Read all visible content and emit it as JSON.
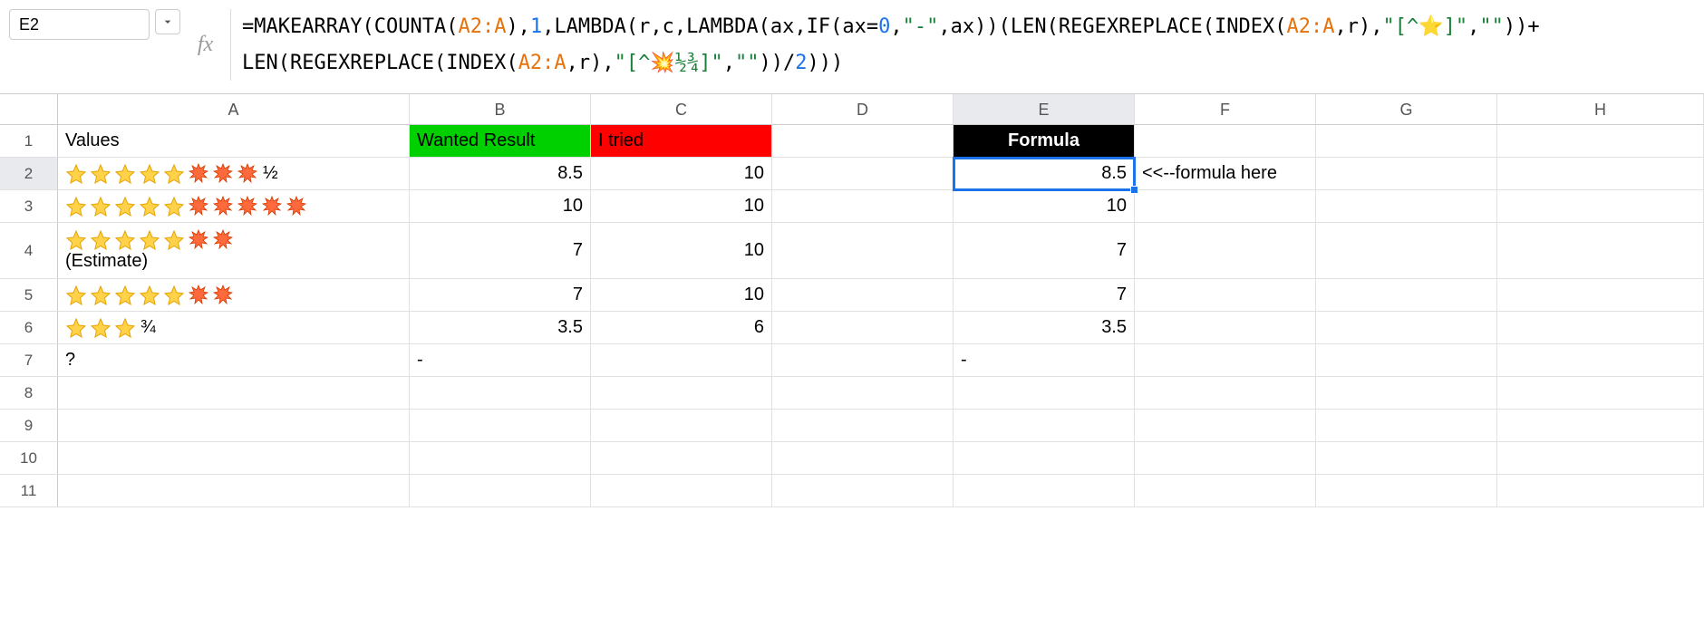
{
  "nameBox": "E2",
  "formula": {
    "segments": [
      {
        "t": "punc",
        "v": "="
      },
      {
        "t": "fn",
        "v": "MAKEARRAY"
      },
      {
        "t": "punc",
        "v": "("
      },
      {
        "t": "fn",
        "v": "COUNTA"
      },
      {
        "t": "punc",
        "v": "("
      },
      {
        "t": "ref",
        "v": "A2:A"
      },
      {
        "t": "punc",
        "v": "),"
      },
      {
        "t": "num",
        "v": "1"
      },
      {
        "t": "punc",
        "v": ","
      },
      {
        "t": "fn",
        "v": "LAMBDA"
      },
      {
        "t": "punc",
        "v": "(r,c,"
      },
      {
        "t": "fn",
        "v": "LAMBDA"
      },
      {
        "t": "punc",
        "v": "(ax,"
      },
      {
        "t": "fn",
        "v": "IF"
      },
      {
        "t": "punc",
        "v": "(ax="
      },
      {
        "t": "num",
        "v": "0"
      },
      {
        "t": "punc",
        "v": ","
      },
      {
        "t": "str",
        "v": "\"-\""
      },
      {
        "t": "punc",
        "v": ",ax))("
      },
      {
        "t": "fn",
        "v": "LEN"
      },
      {
        "t": "punc",
        "v": "("
      },
      {
        "t": "fn",
        "v": "REGEXREPLACE"
      },
      {
        "t": "punc",
        "v": "("
      },
      {
        "t": "fn",
        "v": "INDEX"
      },
      {
        "t": "punc",
        "v": "("
      },
      {
        "t": "ref",
        "v": "A2:A"
      },
      {
        "t": "punc",
        "v": ",r),"
      },
      {
        "t": "str",
        "v": "\"[^⭐]\""
      },
      {
        "t": "punc",
        "v": ","
      },
      {
        "t": "str",
        "v": "\"\""
      },
      {
        "t": "punc",
        "v": "))+"
      },
      {
        "t": "br"
      },
      {
        "t": "fn",
        "v": "LEN"
      },
      {
        "t": "punc",
        "v": "("
      },
      {
        "t": "fn",
        "v": "REGEXREPLACE"
      },
      {
        "t": "punc",
        "v": "("
      },
      {
        "t": "fn",
        "v": "INDEX"
      },
      {
        "t": "punc",
        "v": "("
      },
      {
        "t": "ref",
        "v": "A2:A"
      },
      {
        "t": "punc",
        "v": ",r),"
      },
      {
        "t": "str",
        "v": "\"[^💥½¾]\""
      },
      {
        "t": "punc",
        "v": ","
      },
      {
        "t": "str",
        "v": "\"\""
      },
      {
        "t": "punc",
        "v": "))/"
      },
      {
        "t": "num",
        "v": "2"
      },
      {
        "t": "punc",
        "v": ")))"
      }
    ]
  },
  "columns": [
    "A",
    "B",
    "C",
    "D",
    "E",
    "F",
    "G",
    "H"
  ],
  "rowNumbers": [
    "1",
    "2",
    "3",
    "4",
    "5",
    "6",
    "7",
    "8",
    "9",
    "10",
    "11"
  ],
  "headers": {
    "A": "Values",
    "B": "Wanted Result",
    "C": "I tried",
    "E": "Formula"
  },
  "rows": [
    {
      "stars": 5,
      "collisions": 3,
      "half": "½",
      "estimate": false,
      "B": "8.5",
      "C": "10",
      "E": "8.5",
      "F": "<<--formula here"
    },
    {
      "stars": 5,
      "collisions": 5,
      "half": "",
      "estimate": false,
      "B": "10",
      "C": "10",
      "E": "10",
      "F": ""
    },
    {
      "stars": 5,
      "collisions": 2,
      "half": "",
      "estimate": true,
      "estimateLabel": "(Estimate)",
      "B": "7",
      "C": "10",
      "E": "7",
      "F": ""
    },
    {
      "stars": 5,
      "collisions": 2,
      "half": "",
      "estimate": false,
      "B": "7",
      "C": "10",
      "E": "7",
      "F": ""
    },
    {
      "stars": 3,
      "collisions": 0,
      "half": "¾",
      "estimate": false,
      "B": "3.5",
      "C": "6",
      "E": "3.5",
      "F": ""
    },
    {
      "question": "?",
      "B": "-",
      "C": "",
      "E": "-",
      "F": ""
    }
  ],
  "selectedCell": "E2"
}
